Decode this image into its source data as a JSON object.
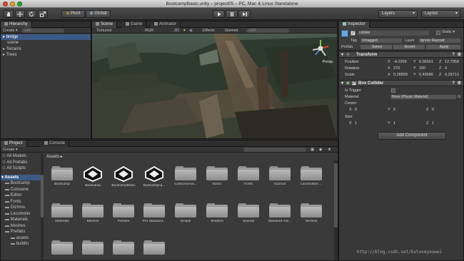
{
  "window": {
    "title": "BootcampBasic.unity – project05 – PC, Mac & Linux Standalone"
  },
  "toolbar": {
    "pivot": "Pivot",
    "global": "Global",
    "layers": "Layers",
    "layout": "Layout"
  },
  "hierarchy": {
    "tab": "Hierarchy",
    "create": "Create",
    "search_placeholder": "⊙All",
    "items": [
      "bridge",
      "scene",
      "Terrains",
      "Trees"
    ]
  },
  "scene_tabs": {
    "scene": "Scene",
    "game": "Game",
    "animator": "Animator"
  },
  "scene_bar": {
    "mode": "Textured",
    "color": "RGB",
    "twod": "2D",
    "effects": "Effects",
    "gizmos": "Gizmos",
    "search_placeholder": "⊙All",
    "persp": "Persp"
  },
  "inspector": {
    "tab": "Inspector",
    "object_name": "collider",
    "static": "Static",
    "tag_label": "Tag",
    "tag_value": "Untagged",
    "layer_label": "Layer",
    "layer_value": "Ignore Raycast",
    "prefab_label": "Prefab",
    "prefab_select": "Select",
    "prefab_revert": "Revert",
    "prefab_apply": "Apply",
    "transform": {
      "title": "Transform",
      "position": {
        "label": "Position",
        "x": "-4.0269",
        "y": "6.06501",
        "z": "12.7958"
      },
      "rotation": {
        "label": "Rotation",
        "x": "270",
        "y": "180",
        "z": "0"
      },
      "scale": {
        "label": "Scale",
        "x": "0.28858",
        "y": "5.49686",
        "z": "0.29713"
      }
    },
    "box_collider": {
      "title": "Box Collider",
      "is_trigger": "Is Trigger",
      "material_label": "Material",
      "material_value": "None (Physic Material)",
      "center_label": "Center",
      "center": {
        "x": "0",
        "y": "0",
        "z": "0"
      },
      "size_label": "Size",
      "size": {
        "x": "1",
        "y": "1",
        "z": "1"
      }
    },
    "add_component": "Add Component",
    "axis": {
      "x": "X",
      "y": "Y",
      "z": "Z"
    }
  },
  "project": {
    "tab": "Project",
    "console_tab": "Console",
    "create": "Create",
    "breadcrumb": "Assets ▸",
    "search_items": [
      "All Models",
      "All Prefabs",
      "All Scripts"
    ],
    "tree": [
      "Assets",
      "Bootcamp",
      "Cutscene",
      "Editor",
      "Fonts",
      "Gizmos",
      "Locomotio",
      "Materials",
      "Meshes",
      "Prefabs",
      "assets",
      "buildin"
    ],
    "assets_row1": [
      "Bootcamp",
      "Bootcamp",
      "BootcampBasic",
      "Bootcampca...",
      "CutsceneAni...",
      "Editor",
      "Fonts",
      "Gizmos",
      "Locomotion ..."
    ],
    "assets_row2": [
      "Materials",
      "Meshes",
      "Prefabs",
      "Pro Standard...",
      "Scripts",
      "Shaders",
      "Sounds",
      "Standard Ass...",
      "Terrains"
    ]
  },
  "watermark": "http://blog.csdn.net/kuloveyouwei",
  "colors": {
    "selection": "#3c5a86",
    "panel": "#383838",
    "accent": "#4a8ad4"
  }
}
